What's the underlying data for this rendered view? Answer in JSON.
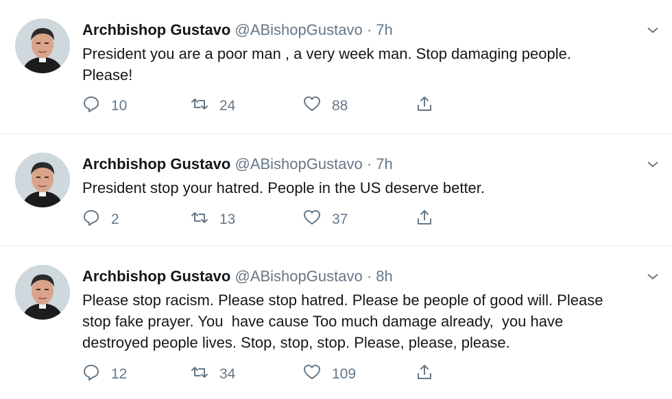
{
  "tweets": [
    {
      "name": "Archbishop Gustavo",
      "handle": "@ABishopGustavo",
      "separator": "·",
      "time": "7h",
      "text": "President you are a poor man , a very week man. Stop damaging people.\nPlease!",
      "replies": "10",
      "retweets": "24",
      "likes": "88"
    },
    {
      "name": "Archbishop Gustavo",
      "handle": "@ABishopGustavo",
      "separator": "·",
      "time": "7h",
      "text": "President stop your hatred. People in the US deserve better.",
      "replies": "2",
      "retweets": "13",
      "likes": "37"
    },
    {
      "name": "Archbishop Gustavo",
      "handle": "@ABishopGustavo",
      "separator": "·",
      "time": "8h",
      "text": "Please stop racism. Please stop hatred. Please be people of good will. Please\nstop fake prayer. You  have cause Too much damage already,  you have\ndestroyed people lives. Stop, stop, stop. Please, please, please.",
      "replies": "12",
      "retweets": "34",
      "likes": "109"
    }
  ],
  "icons": {
    "reply": "reply-icon",
    "retweet": "retweet-icon",
    "like": "heart-icon",
    "share": "share-icon",
    "caret": "chevron-down-icon"
  },
  "colors": {
    "text": "#14171a",
    "secondary": "#657786",
    "divider": "#e6ecf0"
  }
}
